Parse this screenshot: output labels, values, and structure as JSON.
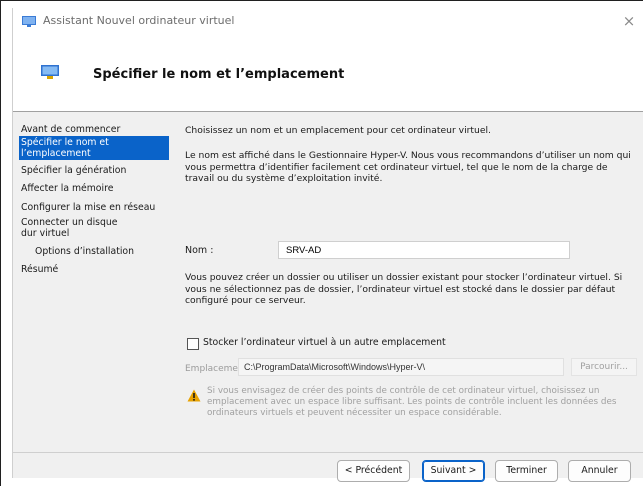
{
  "window": {
    "title": "Assistant Nouvel ordinateur virtuel",
    "close_glyph": "×"
  },
  "header": {
    "title": "Spécifier le nom et l’emplacement"
  },
  "sidebar": {
    "items": [
      {
        "label": "Avant de commencer",
        "active": false
      },
      {
        "label": "Spécifier le nom et l’emplacement",
        "active": true
      },
      {
        "label": "Spécifier la génération",
        "active": false
      },
      {
        "label": "Affecter la mémoire",
        "active": false
      },
      {
        "label": "Configurer la mise en réseau",
        "active": false
      },
      {
        "label": "Connecter un disque dur virtuel",
        "active": false
      },
      {
        "label": "Options d’installation",
        "active": false
      },
      {
        "label": "Résumé",
        "active": false
      }
    ]
  },
  "content": {
    "intro": "Choisissez un nom et un emplacement pour cet ordinateur virtuel.",
    "description": "Le nom est affiché dans le Gestionnaire Hyper-V. Nous vous recommandons d’utiliser un nom qui vous permettra d’identifier facilement cet ordinateur virtuel, tel que le nom de la charge de travail ou du système d’exploitation invité.",
    "name_label": "Nom :",
    "name_value": "SRV-AD",
    "folder_text": "Vous pouvez créer un dossier ou utiliser un dossier existant pour stocker l’ordinateur virtuel. Si vous ne sélectionnez pas de dossier, l’ordinateur virtuel est stocké dans le dossier par défaut configuré pour ce serveur.",
    "store_checkbox_label": "Stocker l’ordinateur virtuel à un autre emplacement",
    "store_checkbox_checked": false,
    "location_label": "Emplacement :",
    "location_value": "C:\\ProgramData\\Microsoft\\Windows\\Hyper-V\\",
    "browse_label": "Parcourir...",
    "warning_text": "Si vous envisagez de créer des points de contrôle de cet ordinateur virtuel, choisissez un emplacement avec un espace libre suffisant. Les points de contrôle incluent les données des ordinateurs virtuels et peuvent nécessiter un espace considérable."
  },
  "footer": {
    "previous_label": "< Précédent",
    "next_label": "Suivant >",
    "finish_label": "Terminer",
    "cancel_label": "Annuler"
  },
  "colors": {
    "accent": "#0a63c9",
    "panel": "#f0f0f0",
    "warning": "#e8a200"
  },
  "icons": {
    "app": "hyperv-monitor-icon",
    "warning": "warning-triangle-icon",
    "close": "close-icon"
  }
}
